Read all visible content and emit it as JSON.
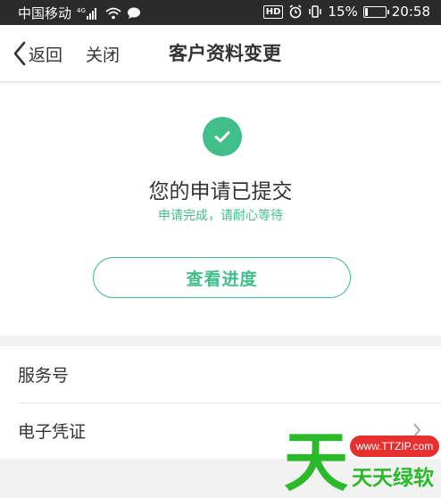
{
  "status_bar": {
    "carrier": "中国移动",
    "network": "4G",
    "hd": "HD",
    "battery": "15%",
    "battery_level": 0.15,
    "time": "20:58"
  },
  "nav": {
    "back_label": "返回",
    "close_label": "关闭",
    "title": "客户资料变更"
  },
  "result": {
    "title": "您的申请已提交",
    "subtitle": "申请完成，请耐心等待",
    "button_label": "查看进度"
  },
  "list": [
    {
      "label": "服务号"
    },
    {
      "label": "电子凭证"
    }
  ],
  "watermark": {
    "big_char": "天",
    "url": "www.TTZIP.com",
    "name": "天天绿软"
  },
  "colors": {
    "accent": "#40bf8a",
    "status_bar": "#2b2b2b",
    "watermark_green": "#29b929",
    "watermark_red": "#e63030"
  }
}
